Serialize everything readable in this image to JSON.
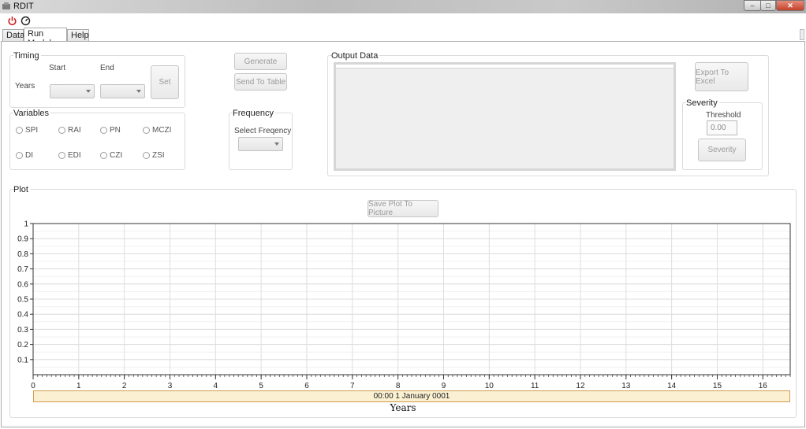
{
  "window": {
    "title": "RDIT",
    "min_label": "–",
    "max_label": "□",
    "close_label": "✕"
  },
  "toolbar": {
    "power_icon": "power-icon",
    "settings_icon": "gauge-icon"
  },
  "tabs": [
    {
      "label": "Data",
      "active": false
    },
    {
      "label": "Run Model",
      "active": true
    },
    {
      "label": "Help",
      "active": false
    }
  ],
  "timing": {
    "title": "Timing",
    "start_label": "Start",
    "end_label": "End",
    "years_label": "Years",
    "start_value": "",
    "end_value": "",
    "set_label": "Set"
  },
  "actions": {
    "generate_label": "Generate",
    "send_label": "Send To Table"
  },
  "variables": {
    "title": "Variables",
    "options": [
      "SPI",
      "RAI",
      "PN",
      "MCZI",
      "DI",
      "EDI",
      "CZI",
      "ZSI"
    ]
  },
  "frequency": {
    "title": "Frequency",
    "select_label": "Select Freqency",
    "value": ""
  },
  "output": {
    "title": "Output Data",
    "export_label": "Export To Excel"
  },
  "severity": {
    "title": "Severity",
    "threshold_label": "Threshold",
    "threshold_value": "0.00",
    "button_label": "Severity"
  },
  "plot": {
    "title": "Plot",
    "save_label": "Save Plot To Picture",
    "time_label": "00:00 1 January 0001",
    "xlabel": "Years"
  },
  "chart_data": {
    "type": "line",
    "xlabel": "Years",
    "ylabel": "",
    "xlim": [
      0,
      16.6
    ],
    "ylim": [
      0,
      1
    ],
    "x_ticks": [
      0,
      1,
      2,
      3,
      4,
      5,
      6,
      7,
      8,
      9,
      10,
      11,
      12,
      13,
      14,
      15,
      16
    ],
    "y_ticks": [
      0.1,
      0.2,
      0.3,
      0.4,
      0.5,
      0.6,
      0.7,
      0.8,
      0.9,
      1
    ],
    "y_tick_labels": [
      "0.1",
      "0.2",
      "0.3",
      "0.4",
      "0.5",
      "0.6",
      "0.7",
      "0.8",
      "0.9",
      "1"
    ],
    "grid": true,
    "series": []
  }
}
